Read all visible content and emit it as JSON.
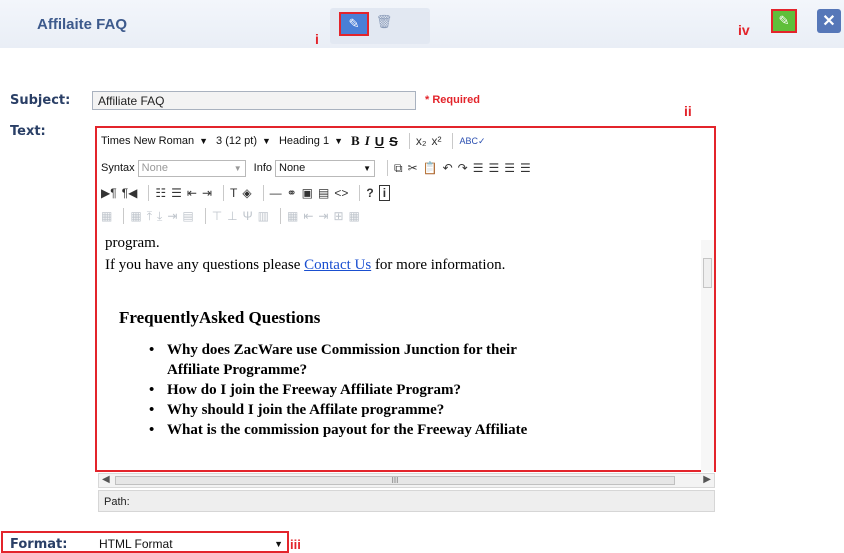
{
  "header": {
    "title": "Affilaite FAQ",
    "markers": {
      "i": "i",
      "ii": "ii",
      "iii": "iii",
      "iv": "iv"
    },
    "edit_icon": "pencil-edit-icon",
    "delete_icon": "trash-icon",
    "close_icon": "close-icon",
    "close_glyph": "✕"
  },
  "form": {
    "subject_label": "Subject:",
    "subject_value": "Affiliate FAQ",
    "required_note": "* Required",
    "text_label": "Text:",
    "format_label": "Format:",
    "format_value": "HTML Format"
  },
  "toolbar": {
    "font_family": "Times New Roman",
    "font_size": "3 (12 pt)",
    "heading": "Heading 1",
    "bold": "B",
    "italic": "I",
    "underline": "U",
    "strike": "S",
    "syntax_label": "Syntax",
    "syntax_value": "None",
    "info_label": "Info",
    "info_value": "None"
  },
  "content": {
    "line1": "program.",
    "line2_before": "If you have any questions please ",
    "line2_link": "Contact Us",
    "line2_after": " for more information.",
    "heading": "FrequentlyAsked Questions",
    "faq_items": [
      "Why does ZacWare use Commission Junction for their",
      "Affiliate Programme?",
      "How do I join the Freeway Affiliate Program?",
      "Why should I join the Affilate programme?",
      "What is the commission payout for the Freeway Affiliate"
    ]
  },
  "statusbar": {
    "path_label": "Path:",
    "scroll_grip": "III"
  },
  "colors": {
    "accent_red": "#e3242b",
    "title_blue": "#3d5a8c",
    "link_blue": "#1a4fd0",
    "edit_green": "#5fbf3a"
  }
}
